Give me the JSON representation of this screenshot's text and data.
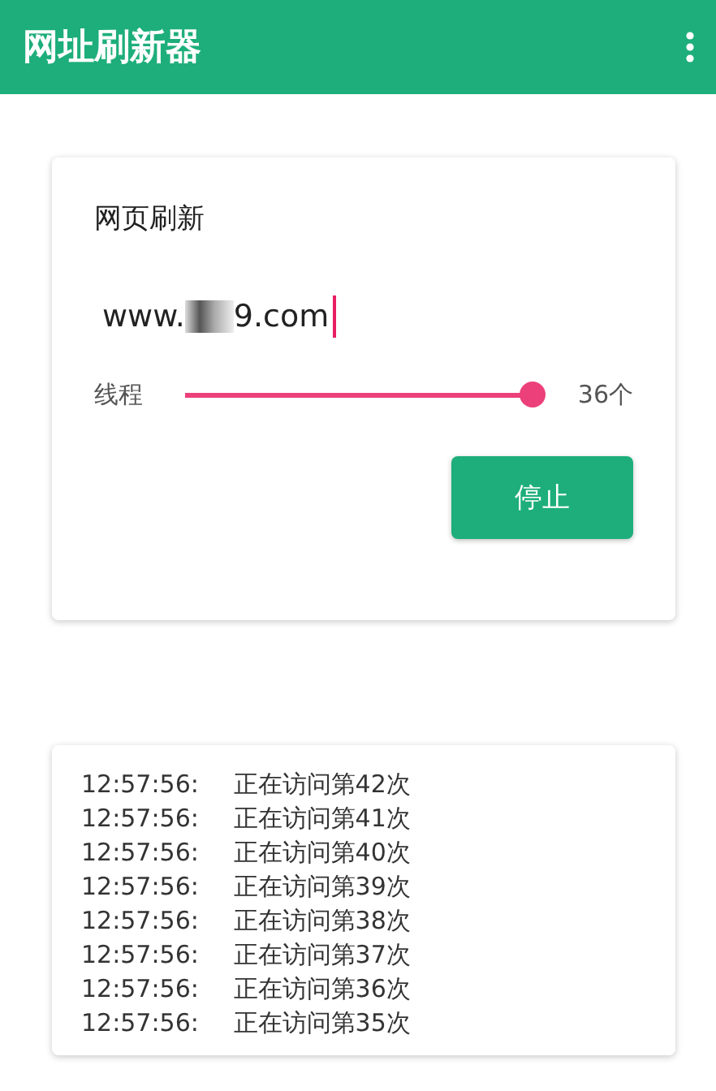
{
  "app_bar": {
    "title": "网址刷新器"
  },
  "refresh_card": {
    "title": "网页刷新",
    "url_field": {
      "value_start": "www.",
      "value_end": "9.com",
      "redacted": true
    },
    "threads": {
      "label": "线程",
      "level": 1.0,
      "reading": "36个"
    },
    "button": "停止"
  },
  "log": [
    {
      "time": "12:57:56:",
      "message": "正在访问第42次"
    },
    {
      "time": "12:57:56:",
      "message": "正在访问第41次"
    },
    {
      "time": "12:57:56:",
      "message": "正在访问第40次"
    },
    {
      "time": "12:57:56:",
      "message": "正在访问第39次"
    },
    {
      "time": "12:57:56:",
      "message": "正在访问第38次"
    },
    {
      "time": "12:57:56:",
      "message": "正在访问第37次"
    },
    {
      "time": "12:57:56:",
      "message": "正在访问第36次"
    },
    {
      "time": "12:57:56:",
      "message": "正在访问第35次"
    }
  ]
}
